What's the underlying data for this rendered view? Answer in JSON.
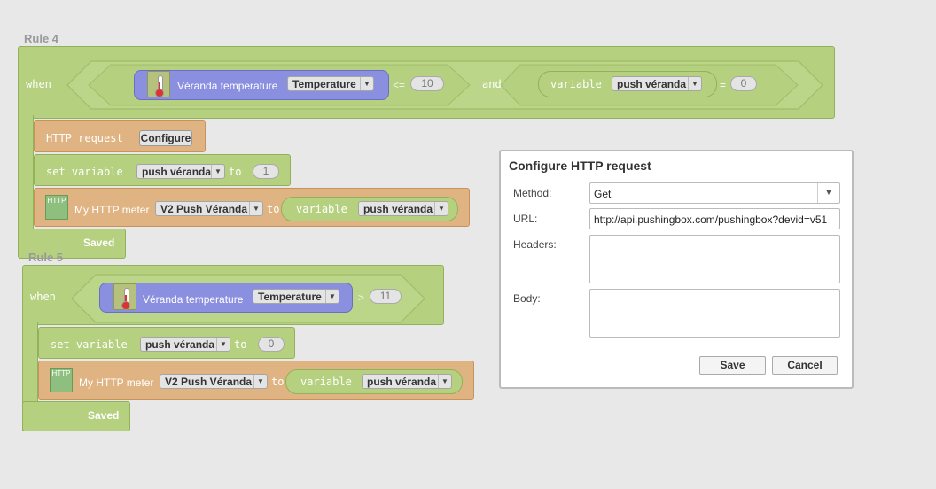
{
  "rule4": {
    "title": "Rule 4",
    "when": "when",
    "sensor_name": "Véranda temperature",
    "sensor_prop": "Temperature",
    "op1": "<=",
    "val1": "10",
    "and": "and",
    "variable_kw": "variable",
    "variable_name": "push véranda",
    "op2": "=",
    "val2": "0",
    "http_request": "HTTP request",
    "configure": "Configure",
    "set_variable": "set variable",
    "set_var_name": "push véranda",
    "to": "to",
    "set_value": "1",
    "http_icon": "HTTP",
    "meter_name": "My HTTP meter",
    "meter_prop": "V2 Push Véranda",
    "to2": "to",
    "meter_variable_kw": "variable",
    "meter_variable": "push véranda",
    "saved": "Saved"
  },
  "rule5": {
    "title": "Rule 5",
    "when": "when",
    "sensor_name": "Véranda temperature",
    "sensor_prop": "Temperature",
    "op1": ">",
    "val1": "11",
    "set_variable": "set variable",
    "set_var_name": "push véranda",
    "to": "to",
    "set_value": "0",
    "http_icon": "HTTP",
    "meter_name": "My HTTP meter",
    "meter_prop": "V2 Push Véranda",
    "to2": "to",
    "meter_variable_kw": "variable",
    "meter_variable": "push véranda",
    "saved": "Saved"
  },
  "dialog": {
    "title": "Configure HTTP request",
    "method_label": "Method:",
    "method_value": "Get",
    "url_label": "URL:",
    "url_value": "http://api.pushingbox.com/pushingbox?devid=v51",
    "headers_label": "Headers:",
    "headers_value": "",
    "body_label": "Body:",
    "body_value": "",
    "save": "Save",
    "cancel": "Cancel"
  },
  "colors": {
    "block_green": "#b5d07f",
    "block_orange": "#e0b482",
    "block_blue": "#8b8fe0",
    "background": "#e8e8e8"
  }
}
